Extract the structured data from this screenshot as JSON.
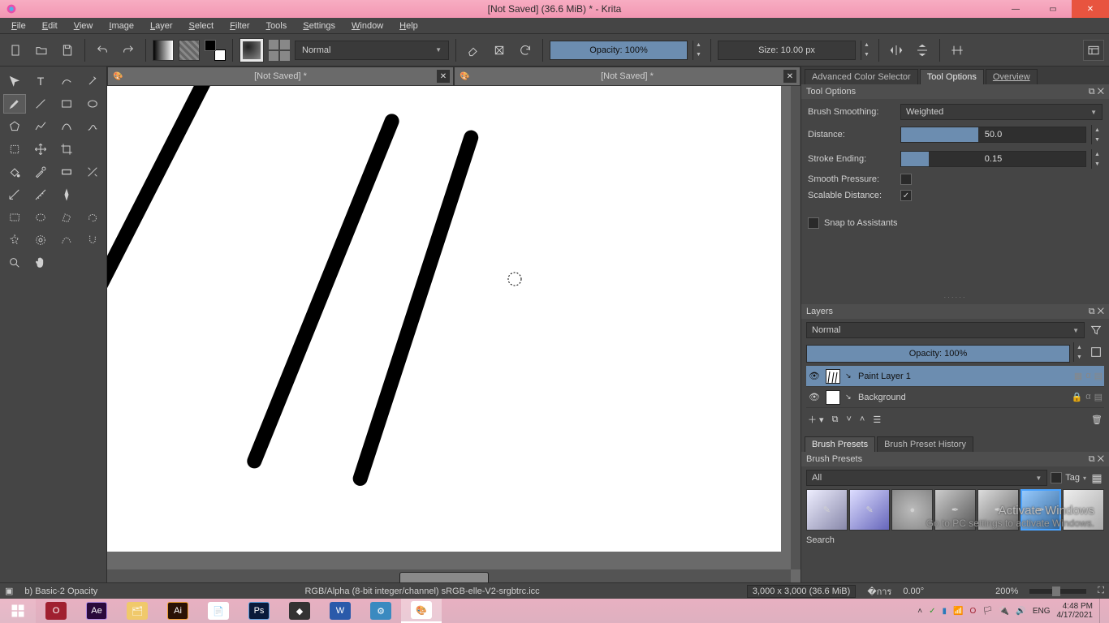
{
  "window": {
    "title": "[Not Saved]  (36.6 MiB)  * - Krita",
    "min": "—",
    "max": "▭",
    "close": "✕"
  },
  "menubar": [
    {
      "ul": "F",
      "rest": "ile"
    },
    {
      "ul": "E",
      "rest": "dit"
    },
    {
      "ul": "V",
      "rest": "iew"
    },
    {
      "ul": "I",
      "rest": "mage"
    },
    {
      "ul": "L",
      "rest": "ayer"
    },
    {
      "ul": "S",
      "rest": "elect"
    },
    {
      "ul": "F",
      "rest": "ilter"
    },
    {
      "ul": "T",
      "rest": "ools"
    },
    {
      "ul": "S",
      "rest": "ettings"
    },
    {
      "ul": "W",
      "rest": "indow"
    },
    {
      "ul": "H",
      "rest": "elp"
    }
  ],
  "toolbar": {
    "blend_mode": "Normal",
    "opacity_label": "Opacity: 100%",
    "size_label": "Size: 10.00 px"
  },
  "doc_tabs": [
    {
      "title": "[Not Saved]  *"
    },
    {
      "title": "[Not Saved]  *"
    }
  ],
  "right_tabs": {
    "acs": "Advanced Color Selector",
    "tool_options": "Tool Options",
    "overview": "Overview"
  },
  "tool_options": {
    "title": "Tool Options",
    "brush_smoothing_label": "Brush Smoothing:",
    "brush_smoothing_value": "Weighted",
    "distance_label": "Distance:",
    "distance_value": "50.0",
    "stroke_ending_label": "Stroke Ending:",
    "stroke_ending_value": "0.15",
    "smooth_pressure_label": "Smooth Pressure:",
    "scalable_distance_label": "Scalable Distance:",
    "snap_label": "Snap to Assistants"
  },
  "layers": {
    "title": "Layers",
    "mode": "Normal",
    "opacity": "Opacity:  100%",
    "items": [
      {
        "name": "Paint Layer 1",
        "selected": true,
        "locked": false
      },
      {
        "name": "Background",
        "selected": false,
        "locked": true
      }
    ]
  },
  "brush_presets": {
    "tab1": "Brush Presets",
    "tab2": "Brush Preset History",
    "title": "Brush Presets",
    "filter": "All",
    "tag_label": "Tag",
    "search_label": "Search"
  },
  "watermark": {
    "line1": "Activate Windows",
    "line2": "Go to PC settings to activate Windows."
  },
  "status": {
    "brush": "b) Basic-2 Opacity",
    "profile": "RGB/Alpha (8-bit integer/channel)  sRGB-elle-V2-srgbtrc.icc",
    "dims": "3,000 x 3,000 (36.6 MiB)",
    "angle": "0.00°",
    "zoom": "200%"
  },
  "taskbar": {
    "lang": "ENG",
    "time": "4:48 PM",
    "date": "4/17/2021"
  }
}
